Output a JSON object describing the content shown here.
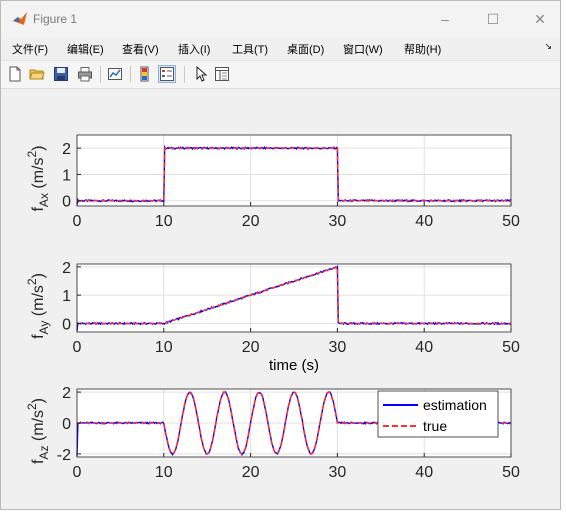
{
  "window": {
    "title": "Figure 1",
    "controls": {
      "minimize": "–",
      "maximize": "☐",
      "close": "✕"
    }
  },
  "menu": {
    "items": [
      "文件(F)",
      "编辑(E)",
      "查看(V)",
      "插入(I)",
      "工具(T)",
      "桌面(D)",
      "窗口(W)",
      "帮助(H)"
    ],
    "overflow_glyph": "↘"
  },
  "toolbar": {
    "icons": [
      "new-figure-icon",
      "open-file-icon",
      "save-icon",
      "print-icon",
      "link-plot-icon",
      "insert-colorbar-icon",
      "insert-legend-icon",
      "edit-plot-arrow-icon",
      "property-inspector-icon"
    ]
  },
  "colors": {
    "estimation": "#0000ff",
    "true": "#ff2f2f",
    "axes_bg": "#ffffff",
    "figure_bg": "#f0f0f0"
  },
  "chart_data": [
    {
      "type": "line",
      "ylabel_main": "f",
      "ylabel_sub": "Ax",
      "ylabel_unit": "(m/s",
      "ylabel_sup": "2",
      "ylabel_close": ")",
      "xlabel": "",
      "xlim": [
        0,
        50
      ],
      "ylim": [
        -0.2,
        2.5
      ],
      "xticks": [
        0,
        10,
        20,
        30,
        40,
        50
      ],
      "yticks": [
        0,
        1,
        2
      ],
      "grid": true,
      "series": [
        {
          "name": "estimation",
          "x": [
            0,
            10,
            10,
            30,
            30,
            50
          ],
          "y": [
            0,
            0,
            2,
            2,
            0,
            0
          ]
        },
        {
          "name": "true",
          "x": [
            0,
            10,
            10,
            30,
            30,
            50
          ],
          "y": [
            0,
            0,
            2,
            2,
            0,
            0
          ]
        }
      ]
    },
    {
      "type": "line",
      "ylabel_main": "f",
      "ylabel_sub": "Ay",
      "ylabel_unit": "(m/s",
      "ylabel_sup": "2",
      "ylabel_close": ")",
      "xlabel": "time (s)",
      "xlim": [
        0,
        50
      ],
      "ylim": [
        -0.3,
        2.1
      ],
      "xticks": [
        0,
        10,
        20,
        30,
        40,
        50
      ],
      "yticks": [
        0,
        1,
        2
      ],
      "grid": true,
      "series": [
        {
          "name": "estimation",
          "x": [
            0,
            10,
            30,
            30,
            50
          ],
          "y": [
            0,
            0,
            2,
            0,
            0
          ]
        },
        {
          "name": "true",
          "x": [
            0,
            10,
            30,
            30,
            50
          ],
          "y": [
            0,
            0,
            2,
            0,
            0
          ]
        }
      ]
    },
    {
      "type": "line",
      "ylabel_main": "f",
      "ylabel_sub": "Az",
      "ylabel_unit": "(m/s",
      "ylabel_sup": "2",
      "ylabel_close": ")",
      "xlabel": "",
      "xlim": [
        0,
        50
      ],
      "ylim": [
        -2.2,
        2.2
      ],
      "xticks": [
        0,
        10,
        20,
        30,
        40,
        50
      ],
      "yticks": [
        -2,
        0,
        2
      ],
      "grid": true,
      "signal": {
        "start": 10,
        "end": 30,
        "amplitude": 2,
        "period": 4
      },
      "legend": {
        "position": "top-right",
        "entries": [
          "estimation",
          "true"
        ]
      },
      "series": [
        {
          "name": "estimation"
        },
        {
          "name": "true"
        }
      ]
    }
  ]
}
